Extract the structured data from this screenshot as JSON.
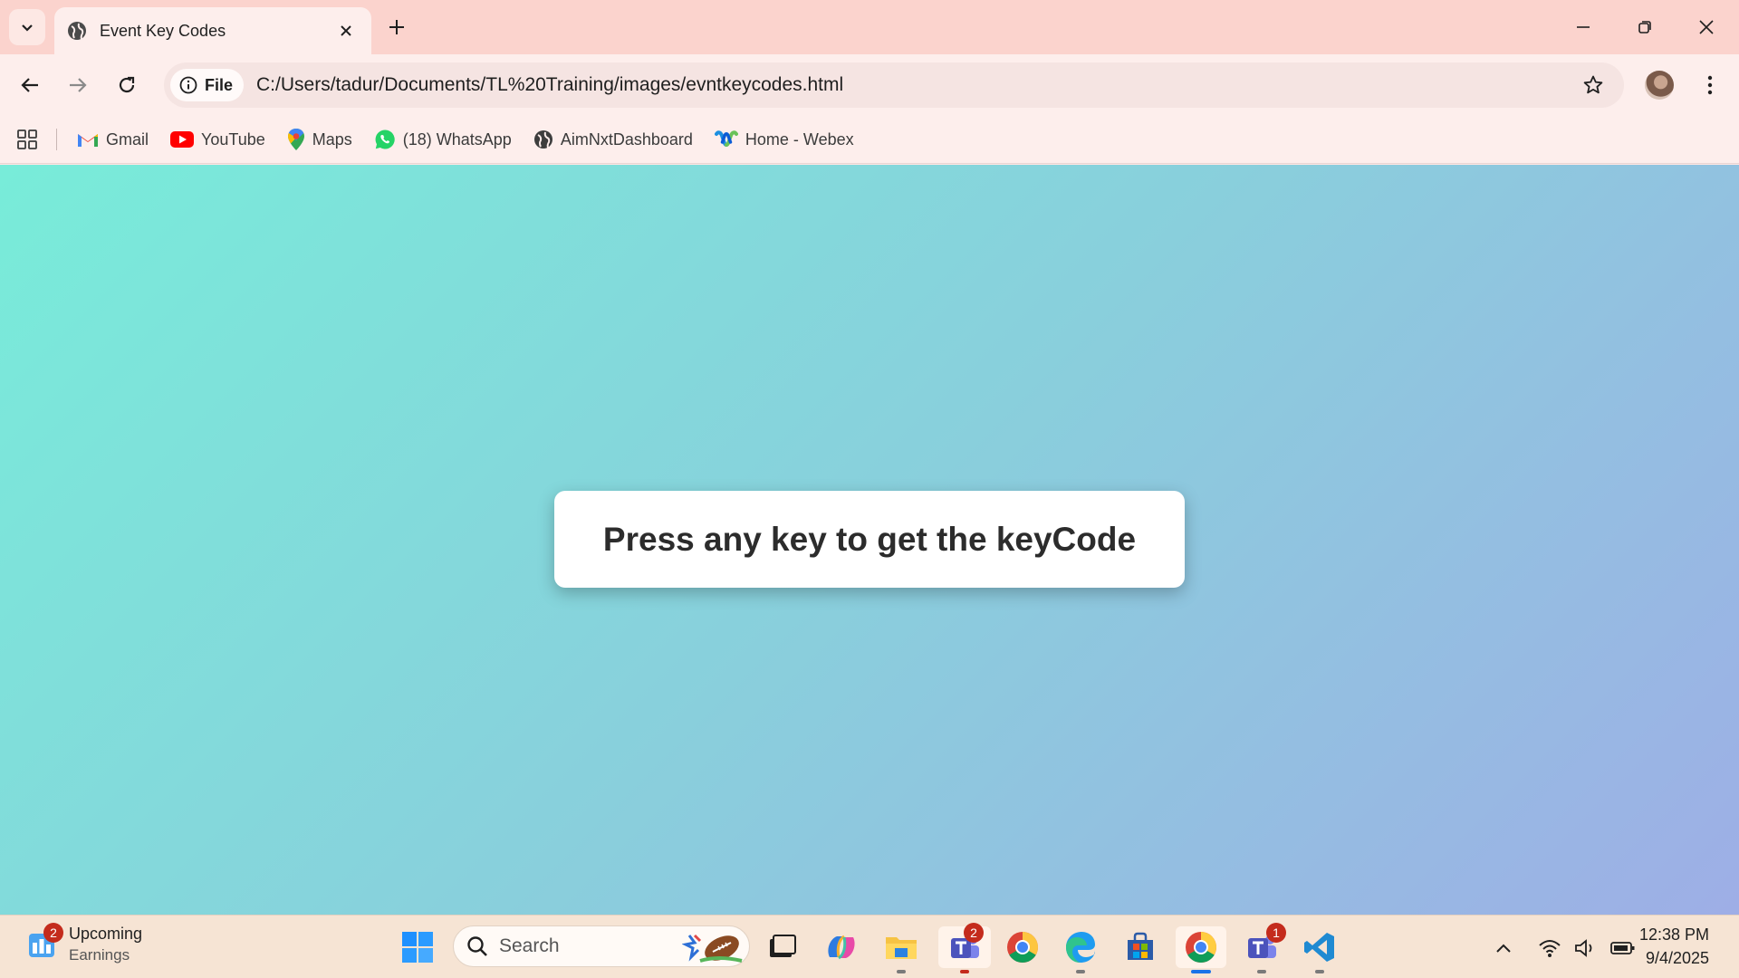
{
  "browser": {
    "tab": {
      "title": "Event Key Codes",
      "favicon": "globe-icon"
    },
    "new_tab_icon": "plus-icon",
    "window_controls": [
      "minimize-icon",
      "restore-icon",
      "close-icon"
    ]
  },
  "toolbar": {
    "site_chip": "File",
    "url": "C:/Users/tadur/Documents/TL%20Training/images/evntkeycodes.html"
  },
  "bookmarks": [
    {
      "label": "Gmail",
      "icon": "gmail-icon"
    },
    {
      "label": "YouTube",
      "icon": "youtube-icon"
    },
    {
      "label": "Maps",
      "icon": "maps-icon"
    },
    {
      "label": "(18) WhatsApp",
      "icon": "whatsapp-icon"
    },
    {
      "label": "AimNxtDashboard",
      "icon": "globe-icon"
    },
    {
      "label": "Home - Webex",
      "icon": "webex-icon"
    }
  ],
  "page": {
    "message": "Press any key to get the keyCode",
    "gradient": [
      "#78ecd9",
      "#9eaee6"
    ]
  },
  "taskbar": {
    "widget": {
      "badge": "2",
      "title": "Upcoming",
      "subtitle": "Earnings"
    },
    "search_label": "Search",
    "teams_badge": "2",
    "teams2_badge": "1",
    "clock": {
      "time": "12:38 PM",
      "date": "9/4/2025"
    }
  }
}
